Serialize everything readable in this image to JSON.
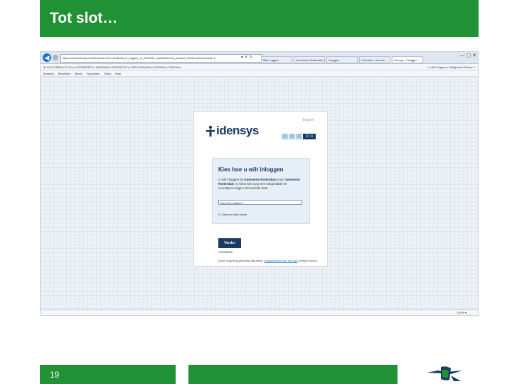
{
  "slide": {
    "title": "Tot slot…",
    "page_number": "19"
  },
  "browser": {
    "address_url": "https://www.idensys.nl/nl/SSO/sso?id=1415ad4a_nu_digimv_nl_0000000_ids0008010ml_product_0004nl-nl/vernieuwd.nl",
    "address_icons": "▾ ✕ ↻",
    "tabs": [
      {
        "label": "Mijn Loggen"
      },
      {
        "label": "Gemeente Rotterdam - Inloggen"
      },
      {
        "label": "Inloggen"
      },
      {
        "label": "Overheid - Vervoer"
      },
      {
        "label": "Idensys - Inloggen"
      }
    ],
    "window_controls": "— ▢ ✕",
    "favorites_bar": "★  CULTUREBLOG.NL  ▸  HYPERKORT ▸  INFOBANK OVERZICHT ▸  OPEN NIEUWS  ▸ DETAILS  ▸  FORUM ▸",
    "menu": [
      "Bestand",
      "Bewerken",
      "Beeld",
      "Favorieten",
      "Extra",
      "Help"
    ],
    "tools": "⌂ ▾  ✉ ▾  Pagina ▾  Veiligheid ▾  Extra ▾  ?",
    "status_zoom": "100% ▾"
  },
  "page": {
    "language_link": "English",
    "logo_text": "idensys",
    "steps": [
      "1",
      "2",
      "3",
      "3 / 4"
    ],
    "login_title": "Kies hoe u wilt inloggen",
    "description_pre": "U wilt inloggen bij ",
    "description_org1": "Gemeente Rotterdam",
    "description_mid": " voor ",
    "description_org2": "Gemeente Rotterdam",
    "description_post": ". U kiest hier voor een inlogmiddel en vervolgens krijgt u het tweede deel.",
    "select_value": "Kies een middel ▾",
    "remember_label": "☑ Onthoud mijn keuze",
    "next_button": "Verder",
    "cancel_link": "Annuleren",
    "footer_pre": "Deze omgeving gebruikt uitsluitend:  ",
    "footer_link": "inlogmiddelen van Idensys",
    "footer_post": " of eigen keuze"
  },
  "colors": {
    "brand_green": "#219135",
    "idensys_navy": "#1a3a63",
    "step_light_blue": "#a9d2ee"
  }
}
